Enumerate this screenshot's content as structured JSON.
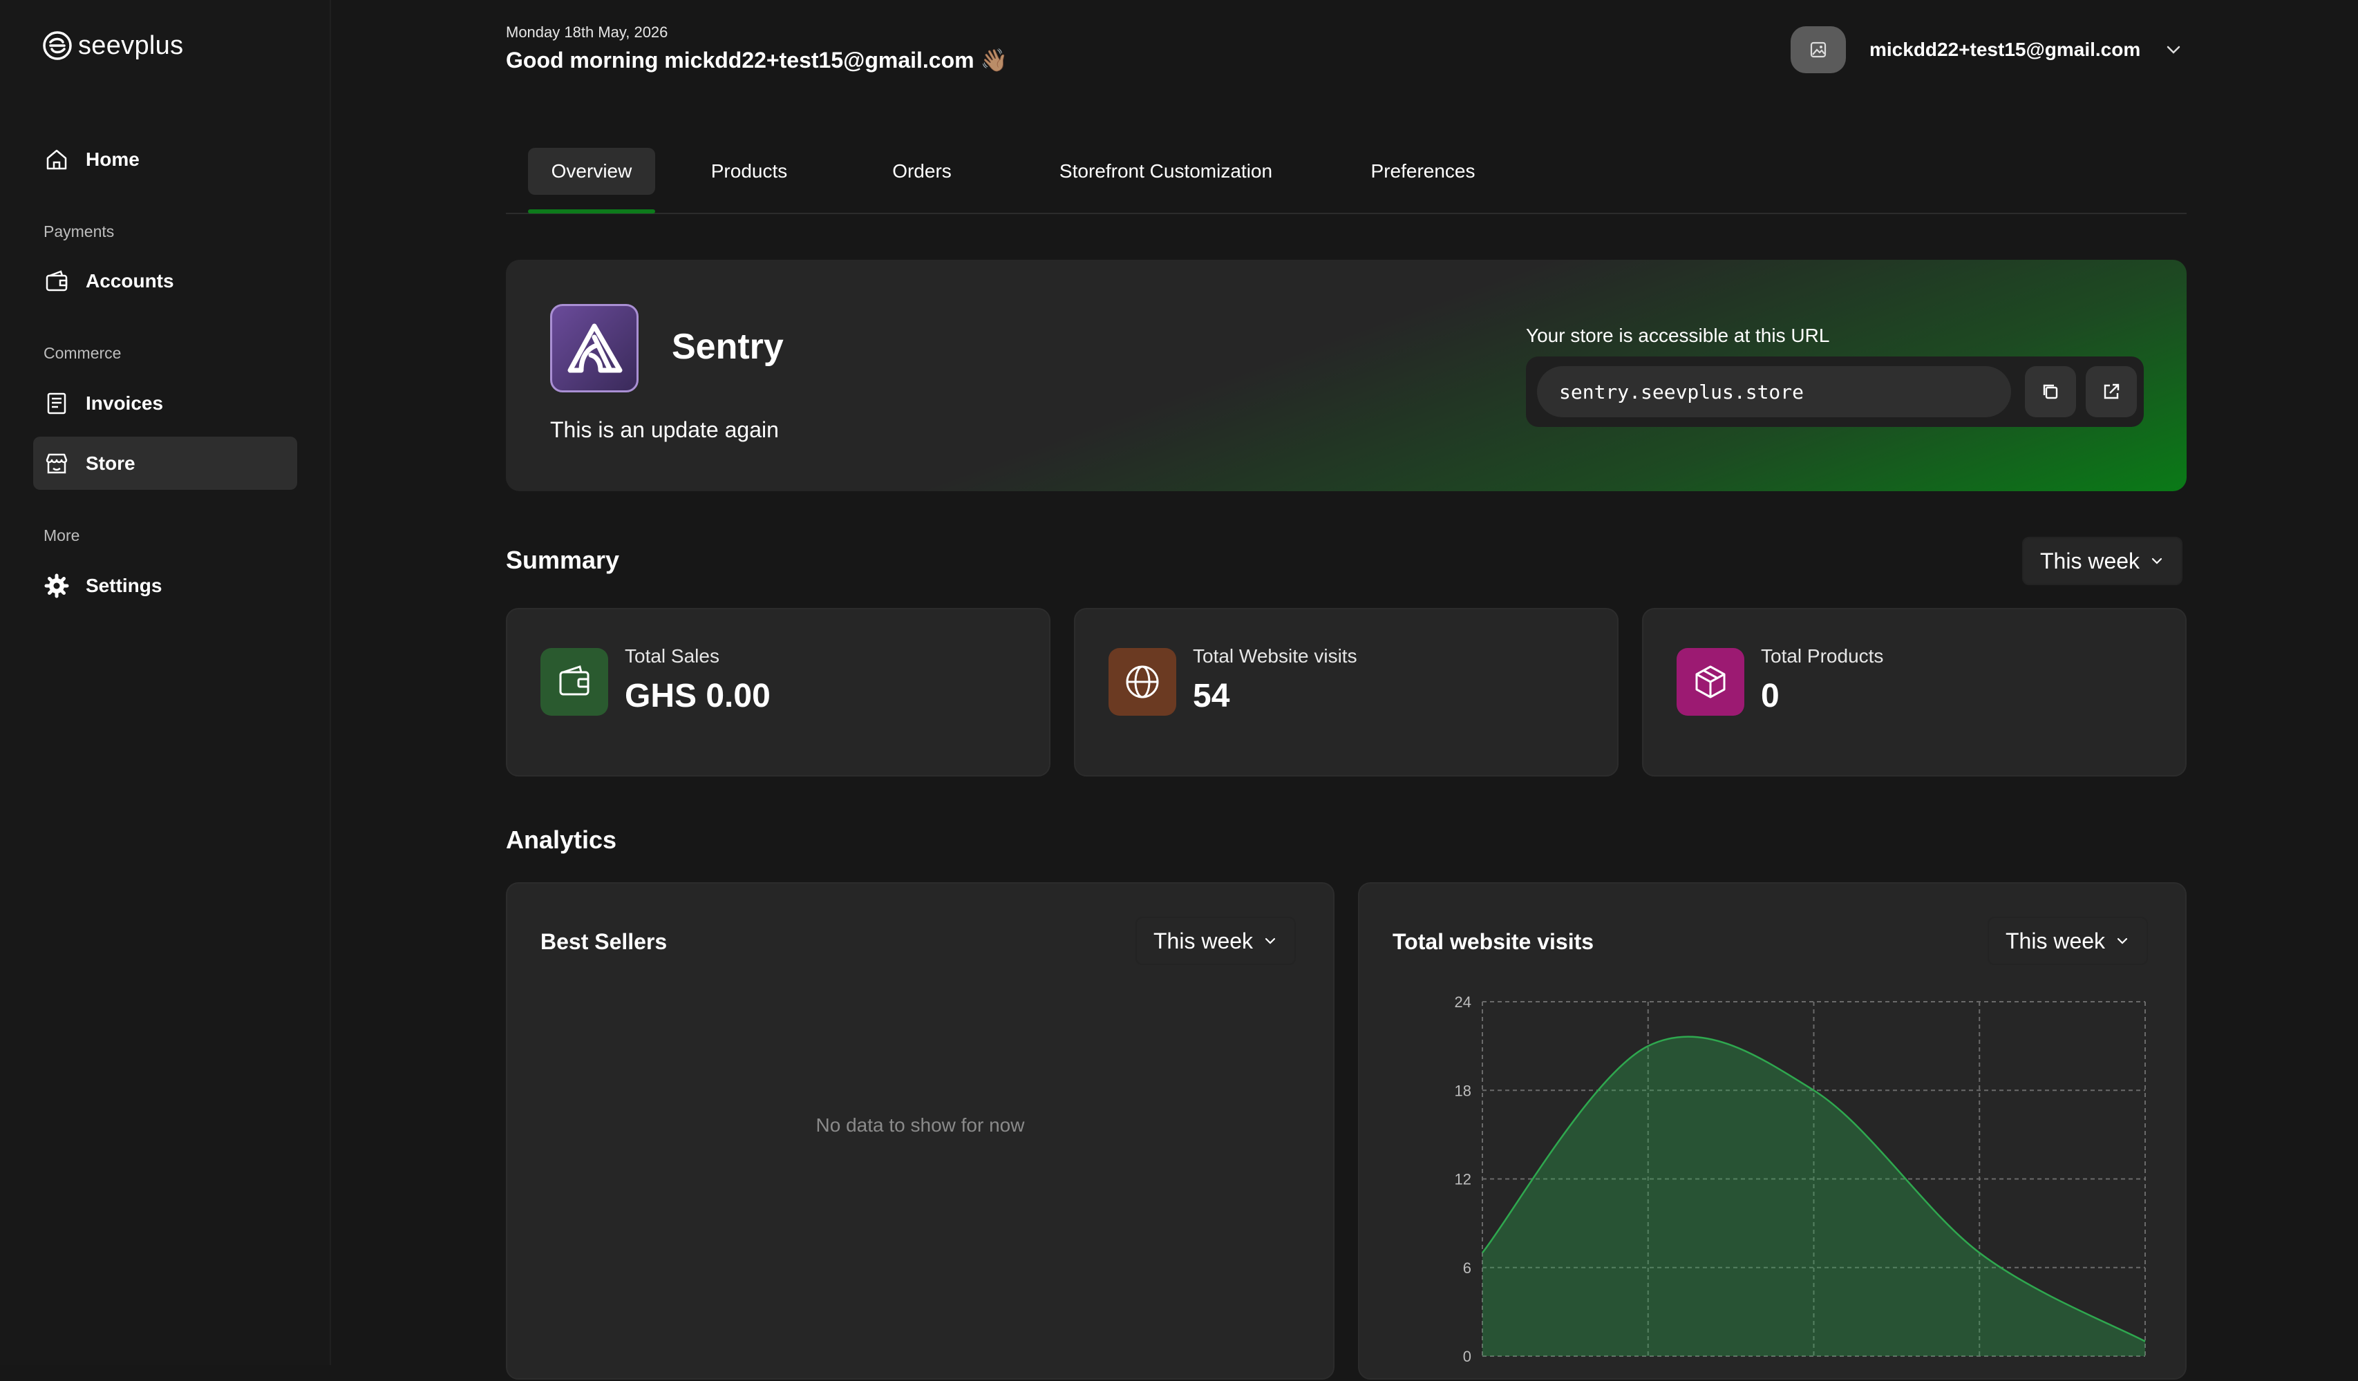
{
  "brand": {
    "name": "seevplus"
  },
  "sidebar": {
    "home": "Home",
    "sections": [
      {
        "title": "Payments",
        "items": [
          {
            "label": "Accounts"
          }
        ]
      },
      {
        "title": "Commerce",
        "items": [
          {
            "label": "Invoices"
          },
          {
            "label": "Store"
          }
        ]
      },
      {
        "title": "More",
        "items": [
          {
            "label": "Settings"
          }
        ]
      }
    ],
    "active_item": "Store"
  },
  "header": {
    "date": "Monday 18th May, 2026",
    "greeting": "Good morning mickdd22+test15@gmail.com 👋🏽",
    "user_email": "mickdd22+test15@gmail.com"
  },
  "tabs": {
    "items": [
      "Overview",
      "Products",
      "Orders",
      "Storefront Customization",
      "Preferences"
    ],
    "active": "Overview"
  },
  "store": {
    "name": "Sentry",
    "description": "This is an update again",
    "url_label": "Your store is accessible at this URL",
    "url": "sentry.seevplus.store"
  },
  "summary": {
    "title": "Summary",
    "period": "This week",
    "cards": [
      {
        "label": "Total Sales",
        "value": "GHS 0.00",
        "icon": "wallet-icon",
        "color": "#2a5a2f"
      },
      {
        "label": "Total Website visits",
        "value": "54",
        "icon": "globe-icon",
        "color": "#6b3a22"
      },
      {
        "label": "Total Products",
        "value": "0",
        "icon": "box-icon",
        "color": "#9c1a72"
      }
    ]
  },
  "analytics": {
    "title": "Analytics",
    "best_sellers": {
      "title": "Best Sellers",
      "period": "This week",
      "empty": "No data to show for now"
    },
    "visits": {
      "title": "Total website visits",
      "period": "This week"
    }
  },
  "chart_data": {
    "type": "area",
    "title": "Total website visits",
    "x": [
      0,
      1,
      2,
      3,
      4
    ],
    "values": [
      7,
      21,
      18,
      7,
      1
    ],
    "yticks": [
      "24",
      "18",
      "12",
      "6",
      "0"
    ],
    "ylim": [
      0,
      24
    ],
    "grid": true,
    "color": "#2fa84f"
  }
}
